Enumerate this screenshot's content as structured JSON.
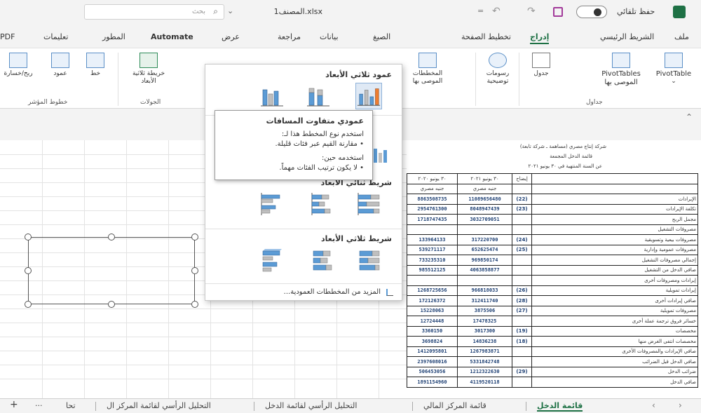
{
  "titlebar": {
    "autosave_label": "حفظ تلقائي",
    "filename": "المصنف1.xlsx",
    "search_placeholder": "بحث"
  },
  "menu_tabs": [
    "ملف",
    "الشريط الرئيسي",
    "إدراج",
    "تخطيط الصفحة",
    "الصيغ",
    "بيانات",
    "مراجعة",
    "عرض",
    "Automate",
    "المطور",
    "تعليمات",
    "PDF"
  ],
  "ribbon": {
    "pivottable": "PivotTable",
    "rec_pivot": "PivotTables الموصى بها",
    "table": "جدول",
    "illustrations": "رسومات توضيحية",
    "rec_charts": "المخططات الموصى بها",
    "map3d": "خريطة ثلاثية الأبعاد",
    "line": "خط",
    "column": "عمود",
    "winloss": "ربح/خسارة",
    "group_tables": "جداول",
    "group_tours": "الجولات",
    "group_sparklines": "خطوط المؤشر"
  },
  "dropdown": {
    "col3d_header": "عمود ثلاثي الأبعاد",
    "bar2d_header": "شريط ثنائي الأبعاد",
    "bar3d_header": "شريط ثلاثي الأبعاد",
    "more_charts": "المزيد من المخططات العمودية..."
  },
  "tooltip": {
    "title": "عمودي متفاوت المسافات",
    "line1": "استخدم نوع المخطط هذا لـ:",
    "line2": "• مقارنة القيم عبر فئات قليلة.",
    "line3": "استخدمه حين:",
    "line4": "• لا يكون ترتيب الفئات مهماً."
  },
  "sheet_table": {
    "title1": "شركة إنتاج مصري (مساهمة ـ شركة تابعة)",
    "title2": "قائمة الدخل المجمعة",
    "title3": "عن السنة المنتهية في ٣٠ يونيو ٢٠٢١",
    "col_note": "إيضاح",
    "col_2021": "٣٠ يونيو ٢٠٢١",
    "col_2020": "٣٠ يونيو ٢٠٢٠",
    "col_unit": "جنيه مصري",
    "rows": [
      {
        "label": "الإيرادات",
        "note": "(22)",
        "v2021": "11089656480",
        "v2020": "8863508735"
      },
      {
        "label": "تكلفة الإيرادات",
        "note": "(23)",
        "v2021": "8048947439",
        "v2020": "2954761300"
      },
      {
        "label": "مجمل الربح",
        "note": "",
        "v2021": "3032709051",
        "v2020": "1718747435"
      },
      {
        "label": "مصروفات التشغيل",
        "note": "",
        "v2021": "",
        "v2020": ""
      },
      {
        "label": "مصروفات بيعية وتسويقية",
        "note": "(24)",
        "v2021": "317220700",
        "v2020": "133964133"
      },
      {
        "label": "مصروفات عمومية وإدارية",
        "note": "(25)",
        "v2021": "652625474",
        "v2020": "539271117"
      },
      {
        "label": "إجمالي مصروفات التشغيل",
        "note": "",
        "v2021": "969850174",
        "v2020": "733235310"
      },
      {
        "label": "صافي الدخل من التشغيل",
        "note": "",
        "v2021": "4063858877",
        "v2020": "985512125"
      },
      {
        "label": "إيرادات ومصروفات أخرى",
        "note": "",
        "v2021": "",
        "v2020": ""
      },
      {
        "label": "إيرادات تمويلية",
        "note": "(26)",
        "v2021": "966818033",
        "v2020": "1268725656"
      },
      {
        "label": "صافي إيرادات أخرى",
        "note": "(28)",
        "v2021": "312411740",
        "v2020": "172126372"
      },
      {
        "label": "مصروفات تمويلية",
        "note": "(27)",
        "v2021": "3875506",
        "v2020": "15228063"
      },
      {
        "label": "خسائر فروق ترجمة عملة أخرى",
        "note": "",
        "v2021": "17478325",
        "v2020": "12724448"
      },
      {
        "label": "مخصصات",
        "note": "(19)",
        "v2021": "3017300",
        "v2020": "3360150"
      },
      {
        "label": "مخصصات انتفى الغرض منها",
        "note": "(18)",
        "v2021": "14836238",
        "v2020": "3698824"
      },
      {
        "label": "صافي الإيرادات والمصروفات الأخرى",
        "note": "",
        "v2021": "1267983871",
        "v2020": "1412095801"
      },
      {
        "label": "صافي الدخل قبل الضرائب",
        "note": "",
        "v2021": "5331842748",
        "v2020": "2397608016"
      },
      {
        "label": "ضرائب الدخل",
        "note": "(29)",
        "v2021": "1212322630",
        "v2020": "506453056"
      },
      {
        "label": "صافي الدخل",
        "note": "",
        "v2021": "4119520118",
        "v2020": "1891154960"
      }
    ]
  },
  "sheet_tabs": {
    "active": "قائمة الدخل",
    "t2": "قائمة المركز المالي",
    "t3": "التحليل الرأسي لقائمة الدخل",
    "t4": "التحليل الرأسي لقائمة المركز ال",
    "t5": "تحا",
    "more": "···",
    "add": "+"
  },
  "colors": {
    "excel_green": "#1e7145",
    "bar_blue": "#5b9bd5",
    "bar_gray": "#bfbfbf",
    "bar_orange": "#ed7d31",
    "table_number_blue": "#1d3f73"
  }
}
